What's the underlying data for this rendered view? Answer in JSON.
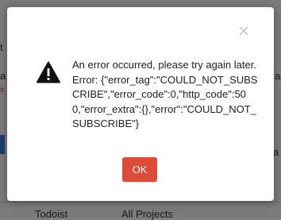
{
  "background": {
    "partial_texts": [
      "t",
      "a",
      "s",
      "a",
      "a",
      "a"
    ],
    "footer_left": "Todoist",
    "footer_right": "All Projects",
    "edge_color": "#3a7bd5",
    "error_text_color": "#d43a2c"
  },
  "dialog": {
    "close_icon": "close-x-icon",
    "warning_icon": "warning-triangle-icon",
    "message": "An error occurred, please try again later. Error: {\"error_tag\":\"COULD_NOT_SUBSCRIBE\",\"error_code\":0,\"http_code\":500,\"error_extra\":{},\"error\":\"COULD_NOT_SUBSCRIBE\"}",
    "ok_label": "OK",
    "ok_color": "#dd4b39"
  }
}
